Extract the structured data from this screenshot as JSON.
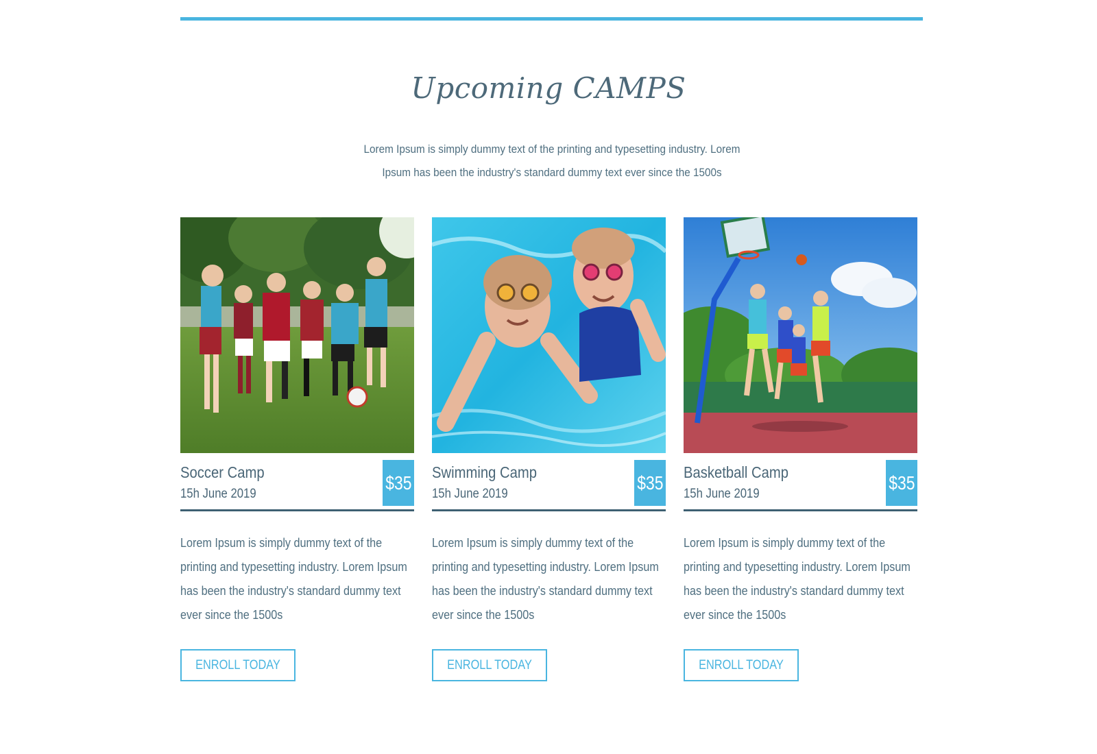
{
  "section": {
    "title": "Upcoming CAMPS",
    "intro": "Lorem Ipsum is simply dummy text of the printing and typesetting industry. Lorem Ipsum has been the industry's standard dummy text ever since the 1500s"
  },
  "colors": {
    "accent": "#49b5e0",
    "text": "#4a6677",
    "divider": "#3e6072"
  },
  "camps": [
    {
      "image": "kids-playing-soccer-photo",
      "name": "Soccer Camp",
      "date": "15h June 2019",
      "price": "$35",
      "description": "Lorem Ipsum is simply dummy text of the printing and typesetting industry. Lorem Ipsum has been the industry's standard dummy text ever since the 1500s",
      "button": "ENROLL TODAY"
    },
    {
      "image": "kids-swimming-underwater-photo",
      "name": "Swimming Camp",
      "date": "15h June 2019",
      "price": "$35",
      "description": "Lorem Ipsum is simply dummy text of the printing and typesetting industry. Lorem Ipsum has been the industry's standard dummy text ever since the 1500s",
      "button": "ENROLL TODAY"
    },
    {
      "image": "kids-playing-basketball-photo",
      "name": "Basketball Camp",
      "date": "15h June 2019",
      "price": "$35",
      "description": "Lorem Ipsum is simply dummy text of the printing and typesetting industry. Lorem Ipsum has been the industry's standard dummy text ever since the 1500s",
      "button": "ENROLL TODAY"
    }
  ]
}
